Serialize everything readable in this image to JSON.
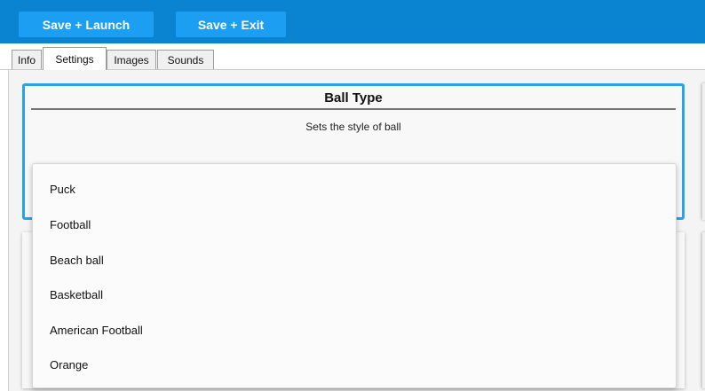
{
  "toolbar": {
    "save_launch_label": "Save + Launch",
    "save_exit_label": "Save + Exit",
    "accent_color": "#0a84d0"
  },
  "tabs": [
    {
      "label": "Info",
      "active": false
    },
    {
      "label": "Settings",
      "active": true
    },
    {
      "label": "Images",
      "active": false
    },
    {
      "label": "Sounds",
      "active": false
    }
  ],
  "setting": {
    "title": "Ball Type",
    "description": "Sets the style of ball"
  },
  "dropdown": {
    "options": [
      "Puck",
      "Football",
      "Beach ball",
      "Basketball",
      "American Football",
      "Orange"
    ]
  },
  "colors": {
    "selection_border": "#27a3ea"
  }
}
